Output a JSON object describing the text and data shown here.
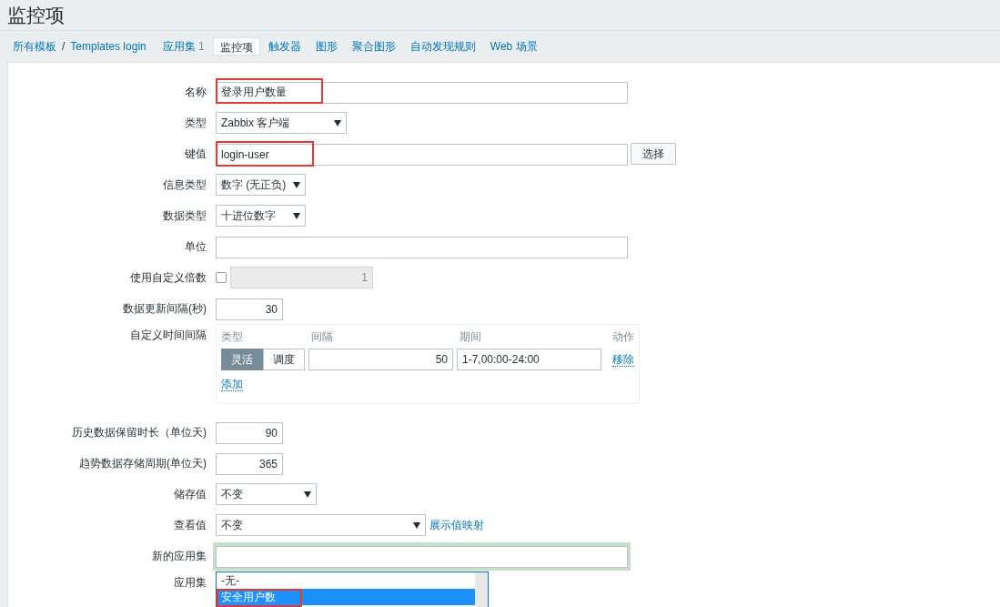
{
  "page_title": "监控项",
  "breadcrumb_separator": "/",
  "breadcrumb": [
    {
      "label": "所有模板"
    },
    {
      "label": "Templates login"
    }
  ],
  "tabs": [
    {
      "label": "应用集",
      "count": "1",
      "selected": false
    },
    {
      "label": "监控项",
      "selected": true
    },
    {
      "label": "触发器",
      "selected": false
    },
    {
      "label": "图形",
      "selected": false
    },
    {
      "label": "聚合图形",
      "selected": false
    },
    {
      "label": "自动发现规则",
      "selected": false
    },
    {
      "label": "Web 场景",
      "selected": false
    }
  ],
  "form": [
    {
      "kind": "text",
      "label": "名称",
      "value": "登录用户数量",
      "highlighted": true
    },
    {
      "kind": "select",
      "label": "类型",
      "value": "Zabbix 客户端"
    },
    {
      "kind": "text",
      "label": "键值",
      "value": "login-user",
      "highlighted": true,
      "button": "选择"
    },
    {
      "kind": "select",
      "label": "信息类型",
      "value": "数字 (无正负)"
    },
    {
      "kind": "select",
      "label": "数据类型",
      "value": "十进位数字"
    },
    {
      "kind": "text",
      "label": "单位"
    },
    {
      "kind": "checkbox_number",
      "label": "使用自定义倍数",
      "checked": false,
      "value": "1"
    },
    {
      "kind": "number",
      "label": "数据更新间隔(秒)",
      "value": "30"
    },
    {
      "kind": "intervals",
      "label": "自定义时间间隔",
      "columns": [
        "类型",
        "间隔",
        "期间",
        "动作"
      ],
      "rows": [
        {
          "modes": [
            {
              "label": "灵活",
              "selected": true
            },
            {
              "label": "调度",
              "selected": false
            }
          ],
          "interval": "50",
          "period": "1-7,00:00-24:00",
          "action": "移除"
        }
      ],
      "add": "添加"
    },
    {
      "kind": "number",
      "label": "历史数据保留时长（单位天)",
      "value": "90"
    },
    {
      "kind": "number",
      "label": "趋势数据存储周期(单位天)",
      "value": "365"
    },
    {
      "kind": "select",
      "label": "储存值",
      "value": "不变"
    },
    {
      "kind": "select",
      "label": "查看值",
      "value": "不变",
      "link": "展示值映射"
    },
    {
      "kind": "text",
      "label": "新的应用集",
      "focused": true
    },
    {
      "kind": "listbox",
      "label": "应用集",
      "options": [
        {
          "label": "-无-",
          "selected": false
        },
        {
          "label": "安全用户数",
          "selected": true,
          "highlighted": true
        }
      ]
    }
  ]
}
